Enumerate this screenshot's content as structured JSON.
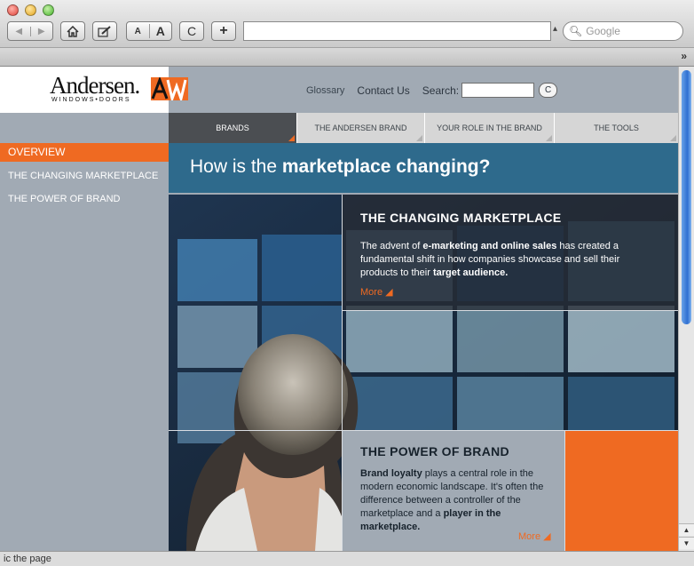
{
  "browser": {
    "search_placeholder": "Google",
    "nav_back": "◀",
    "nav_forward": "▶",
    "text_smaller": "A",
    "text_bigger": "A",
    "reload": "C",
    "add": "+",
    "bookmarks_more": "»",
    "status_text": "ic the page"
  },
  "header": {
    "logo_word": "Andersen.",
    "logo_sub": "WINDOWS•DOORS",
    "glossary": "Glossary",
    "contact": "Contact Us",
    "search_label": "Search:",
    "search_button": "C"
  },
  "tabs": [
    {
      "label": "BRANDS"
    },
    {
      "label": "THE ANDERSEN BRAND"
    },
    {
      "label": "YOUR ROLE IN THE BRAND"
    },
    {
      "label": "THE TOOLS"
    }
  ],
  "sidenav": [
    {
      "label": "OVERVIEW"
    },
    {
      "label": "THE CHANGING MARKETPLACE"
    },
    {
      "label": "THE POWER OF BRAND"
    }
  ],
  "hero": {
    "title_plain": "How is the ",
    "title_bold": "marketplace changing?"
  },
  "panel_marketplace": {
    "heading": "THE CHANGING MARKETPLACE",
    "t1": "The advent of ",
    "b1": "e-marketing and online sales",
    "t2": " has created a fundamental shift in how companies showcase and sell their products to their ",
    "b2": "target audience.",
    "more": "More"
  },
  "panel_brand": {
    "heading": "THE POWER OF BRAND",
    "b1": "Brand loyalty",
    "t1": " plays a central role in the modern economic landscape. It's often the difference between a controller of the marketplace and a ",
    "b2": "player in the marketplace.",
    "more": "More"
  },
  "colors": {
    "accent": "#ef6a22",
    "hero_blue": "#2e6a8c",
    "page_grey": "#a1aab4",
    "active_tab": "#4b4e52"
  }
}
